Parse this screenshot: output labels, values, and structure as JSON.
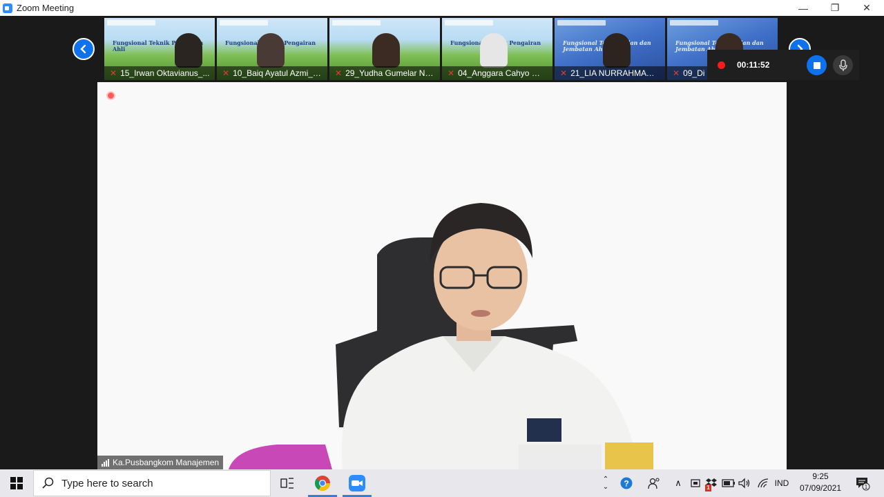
{
  "window": {
    "title": "Zoom Meeting"
  },
  "gallery": {
    "participants": [
      {
        "name": "15_Irwan Oktavianus_...",
        "slide": "green",
        "title": "Fungsional Teknik Pengairan Ahli"
      },
      {
        "name": "10_Baiq Ayatul Azmi_B...",
        "slide": "green",
        "title": "Fungsional Teknik Pengairan"
      },
      {
        "name": "29_Yudha Gumelar Nu...",
        "slide": "green",
        "title": ""
      },
      {
        "name": "04_Anggara Cahyo Wi...",
        "slide": "green",
        "title": "Fungsional Teknik Pengairan"
      },
      {
        "name": "21_LIA NURRAHMAWA...",
        "slide": "blue",
        "title": "Fungsional Teknik Jalan dan Jembatan Ahli"
      },
      {
        "name": "09_Di",
        "slide": "blue",
        "title": "Fungsional Teknik Jalan dan Jembatan Ahli"
      }
    ]
  },
  "recording": {
    "elapsed": "00:11:52"
  },
  "active_speaker": {
    "name": "Ka.Pusbangkom Manajemen"
  },
  "taskbar": {
    "search_placeholder": "Type here to search",
    "language": "IND",
    "time": "9:25",
    "date": "07/09/2021",
    "notification_count": "1",
    "tray_badge": "1"
  },
  "colors": {
    "zoom_blue": "#0e72ed",
    "record_red": "#ff1a1a",
    "mute_red": "#e53935"
  }
}
